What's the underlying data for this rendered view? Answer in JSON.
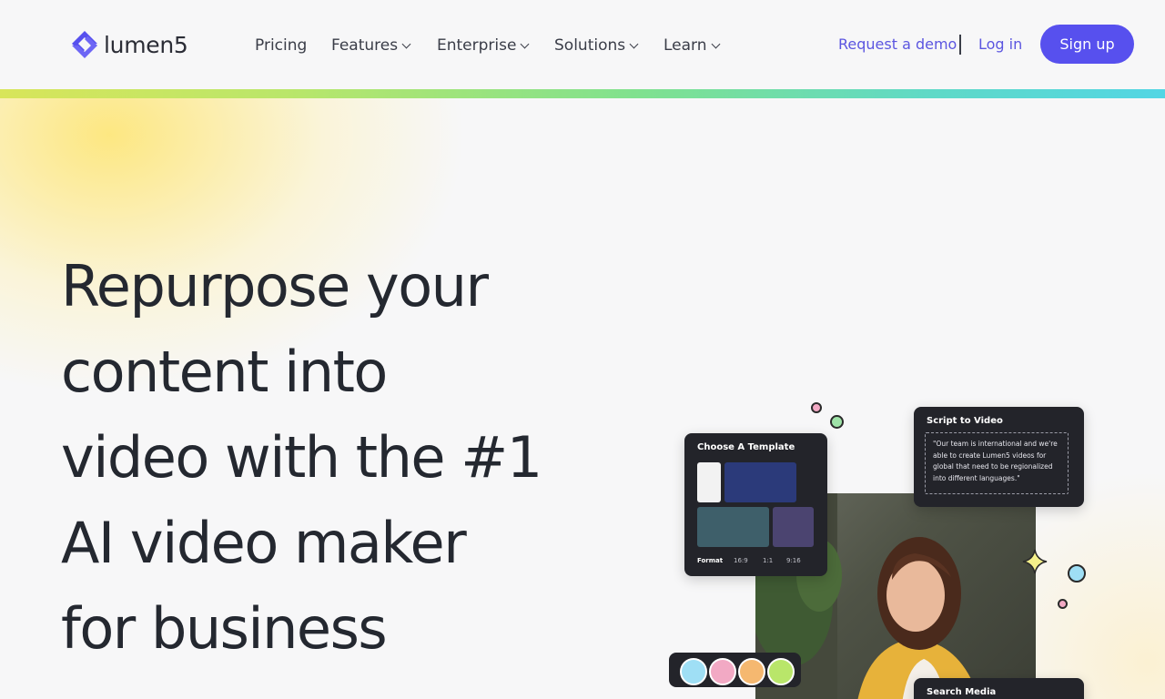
{
  "brand": {
    "name": "lumen5",
    "accent": "#5750ee"
  },
  "nav": {
    "items": [
      {
        "label": "Pricing",
        "has_dropdown": false
      },
      {
        "label": "Features",
        "has_dropdown": true
      },
      {
        "label": "Enterprise",
        "has_dropdown": true
      },
      {
        "label": "Solutions",
        "has_dropdown": true
      },
      {
        "label": "Learn",
        "has_dropdown": true
      }
    ],
    "request_demo": "Request a demo",
    "login": "Log in",
    "signup": "Sign up"
  },
  "hero": {
    "headline_lines": [
      "Repurpose your",
      "content into",
      "video with the #1",
      "AI video maker",
      "for business"
    ]
  },
  "illustration": {
    "template_card": {
      "title": "Choose A Template",
      "format_label": "Format",
      "formats": [
        "16:9",
        "1:1",
        "9:16"
      ]
    },
    "script_card": {
      "title": "Script to Video",
      "quote": "\"Our team is international and we're able to create Lumen5 videos for global that need to be regionalized into different languages.\""
    },
    "media_card": {
      "title": "Search Media"
    }
  }
}
